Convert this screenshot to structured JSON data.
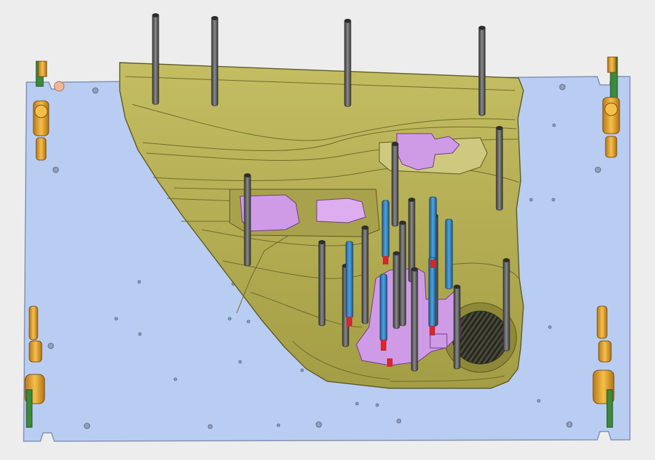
{
  "scene": {
    "description_free": true,
    "colors": {
      "background": "#ededed",
      "base_plate": "#b9cdf2",
      "base_plate_edge": "#7f91b5",
      "door_panel": "#b9b25a",
      "door_panel_dark": "#8e8838",
      "door_panel_light": "#d2cc7a",
      "support_rod": "#5d5d5d",
      "support_rod_blue": "#2f7fbf",
      "rod_tip_red": "#d2282e",
      "purple_part": "#cf9be6",
      "locator_orange": "#e9a62b",
      "locator_green": "#3c8a3c",
      "speaker_grille": "#3b3b3b"
    },
    "icons": [
      "locating-pin-icon",
      "clamp-icon",
      "support-rod-icon"
    ]
  }
}
